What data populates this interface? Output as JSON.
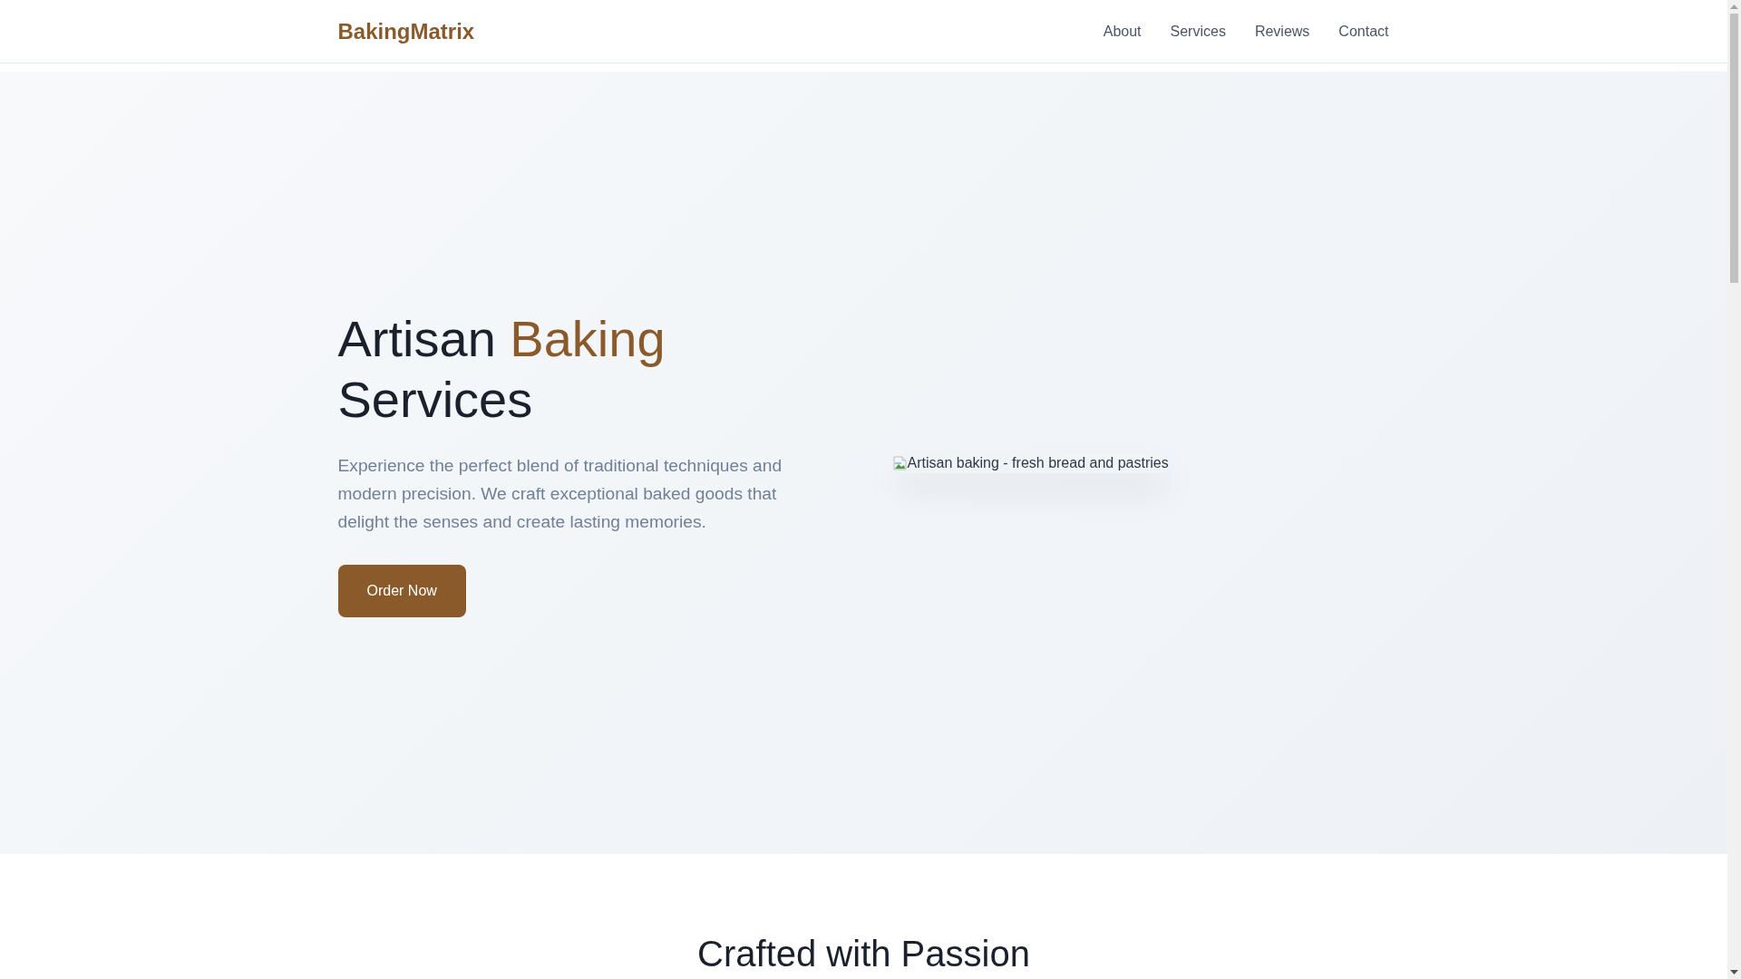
{
  "header": {
    "logo": "BakingMatrix",
    "nav": [
      "About",
      "Services",
      "Reviews",
      "Contact"
    ]
  },
  "hero": {
    "title": [
      {
        "text": "Artisan ",
        "accent": false
      },
      {
        "text": "Baking",
        "accent": true
      },
      {
        "text": " Services",
        "accent": false
      }
    ],
    "description": "Experience the perfect blend of traditional techniques and modern precision. We craft exceptional baked goods that delight the senses and create lasting memories.",
    "button": "Order Now",
    "image": {
      "alt_text": "Artisan baking - fresh bread and pastries"
    }
  },
  "section": {
    "heading": "Crafted with Passion"
  }
}
